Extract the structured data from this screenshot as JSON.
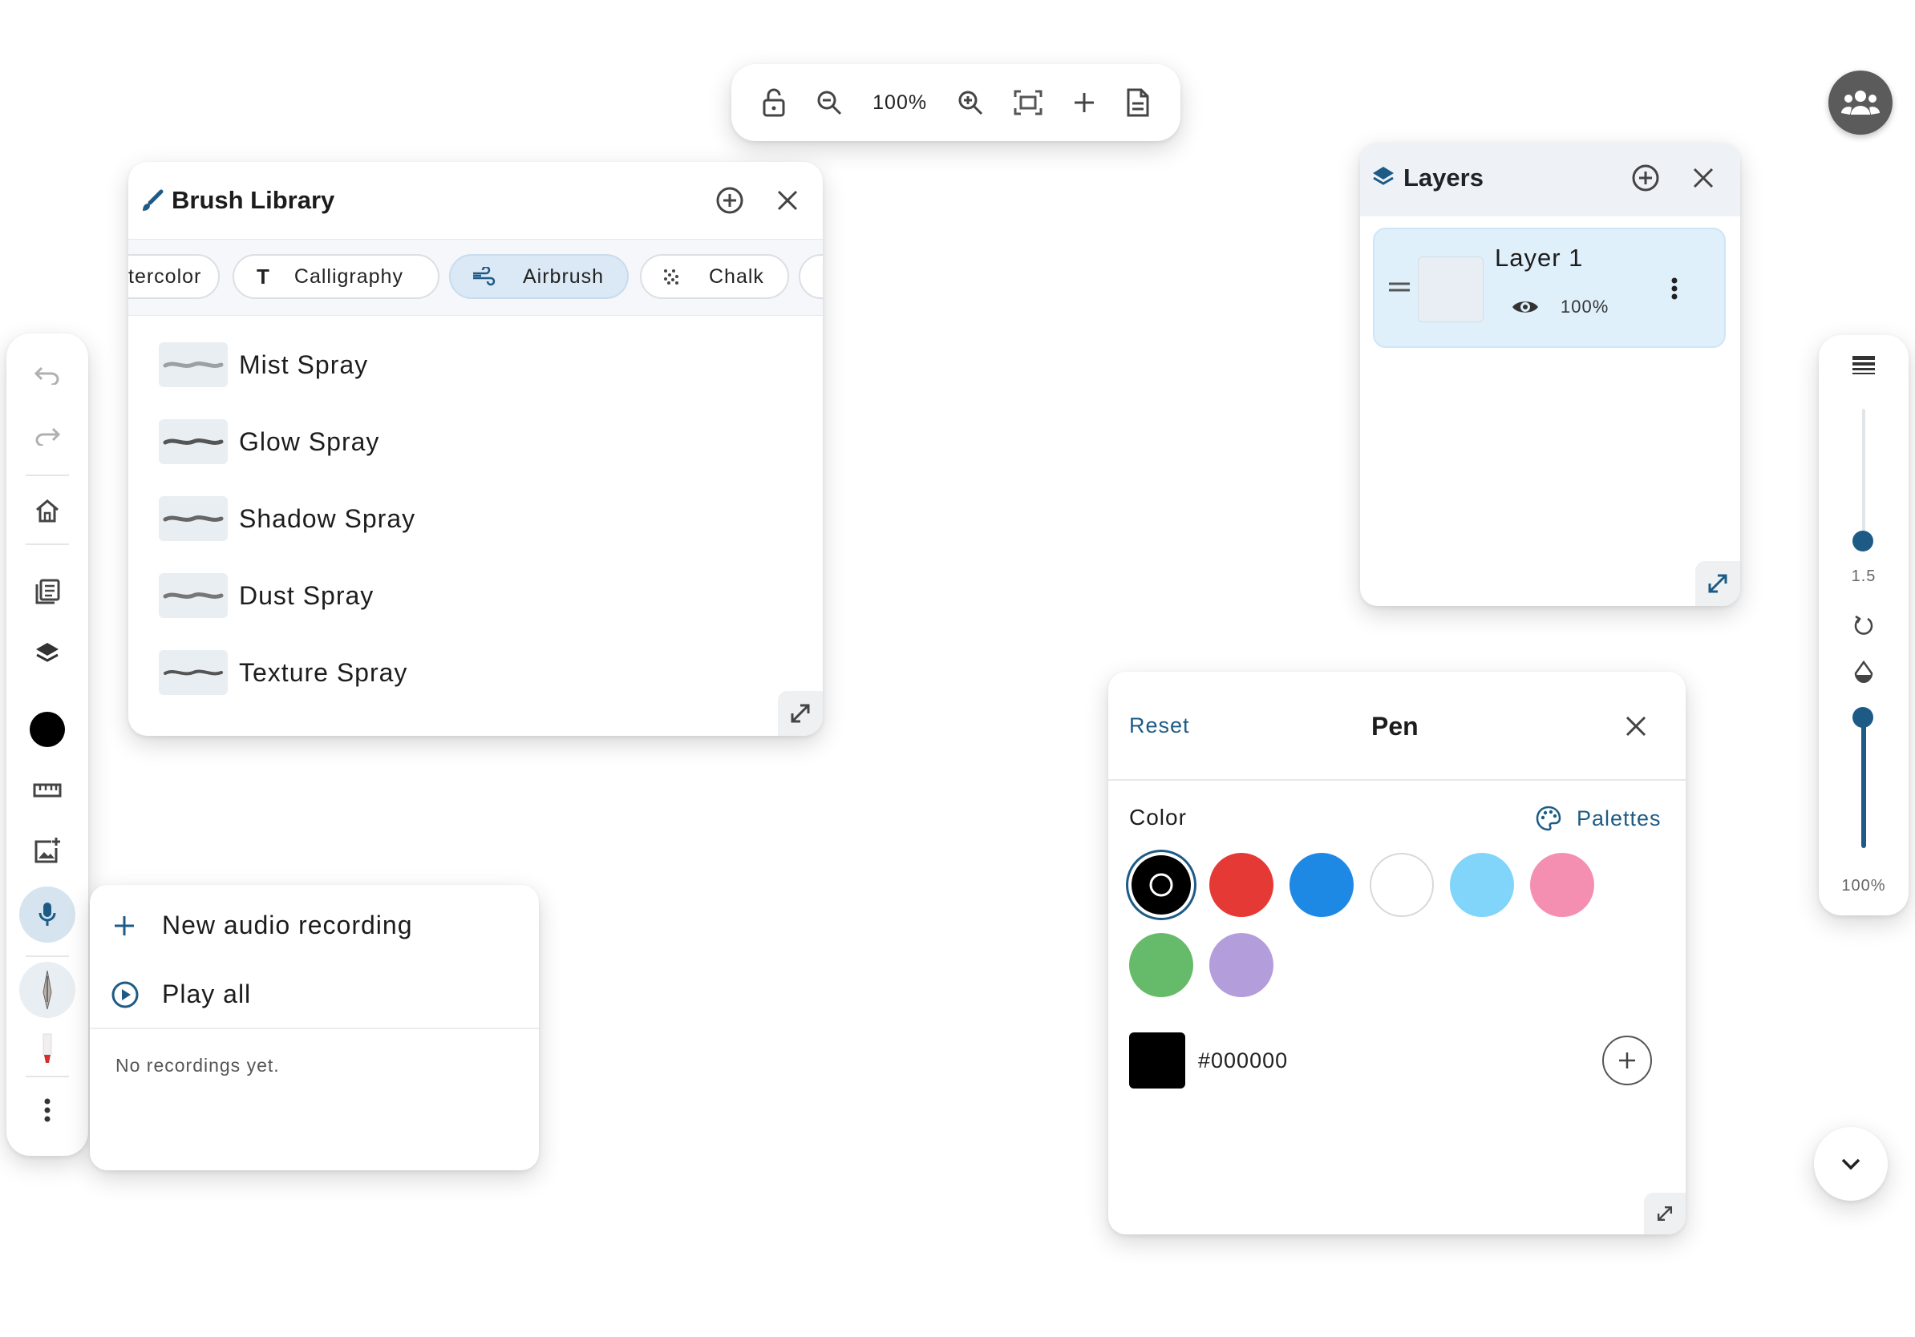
{
  "toolbar": {
    "zoom": "100%"
  },
  "brush_library": {
    "title": "Brush Library",
    "categories": [
      "tercolor",
      "Calligraphy",
      "Airbrush",
      "Chalk"
    ],
    "active_category": "Airbrush",
    "brushes": [
      "Mist Spray",
      "Glow Spray",
      "Shadow Spray",
      "Dust Spray",
      "Texture Spray"
    ]
  },
  "layers": {
    "title": "Layers",
    "items": [
      {
        "name": "Layer 1",
        "opacity": "100%"
      }
    ]
  },
  "pen": {
    "reset_label": "Reset",
    "title": "Pen",
    "color_label": "Color",
    "palettes_label": "Palettes",
    "colors": [
      "#000000",
      "#e53935",
      "#1e88e5",
      "#ffffff",
      "#81d4fa",
      "#f48fb1",
      "#66bb6a",
      "#b39ddb"
    ],
    "selected_color_index": 0,
    "hex_value": "#000000"
  },
  "right_panel": {
    "size_value": "1.5",
    "opacity_value": "100%"
  },
  "audio": {
    "new_label": "New audio recording",
    "play_all_label": "Play all",
    "empty_label": "No recordings yet."
  },
  "accent_color": "#1d5b86"
}
